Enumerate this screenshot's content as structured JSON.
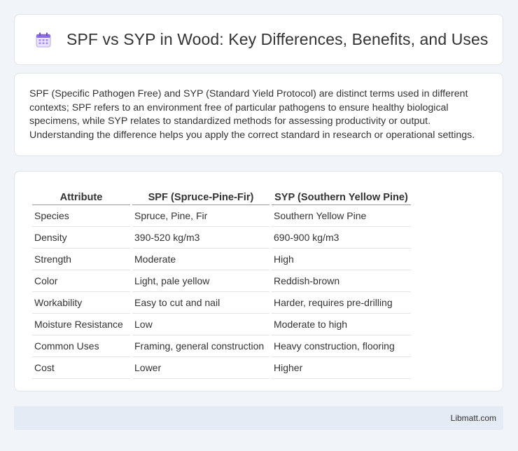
{
  "header": {
    "title": "SPF vs SYP in Wood: Key Differences, Benefits, and Uses",
    "icon": "calendar-icon",
    "icon_color": "#8d6be8"
  },
  "intro": {
    "text": "SPF (Specific Pathogen Free) and SYP (Standard Yield Protocol) are distinct terms used in different contexts; SPF refers to an environment free of particular pathogens to ensure healthy biological specimens, while SYP relates to standardized methods for assessing productivity or output. Understanding the difference helps you apply the correct standard in research or operational settings."
  },
  "table": {
    "headers": [
      "Attribute",
      "SPF (Spruce-Pine-Fir)",
      "SYP (Southern Yellow Pine)"
    ],
    "rows": [
      [
        "Species",
        "Spruce, Pine, Fir",
        "Southern Yellow Pine"
      ],
      [
        "Density",
        "390-520 kg/m3",
        "690-900 kg/m3"
      ],
      [
        "Strength",
        "Moderate",
        "High"
      ],
      [
        "Color",
        "Light, pale yellow",
        "Reddish-brown"
      ],
      [
        "Workability",
        "Easy to cut and nail",
        "Harder, requires pre-drilling"
      ],
      [
        "Moisture Resistance",
        "Low",
        "Moderate to high"
      ],
      [
        "Common Uses",
        "Framing, general construction",
        "Heavy construction, flooring"
      ],
      [
        "Cost",
        "Lower",
        "Higher"
      ]
    ]
  },
  "footer": {
    "brand": "Libmatt.com"
  }
}
